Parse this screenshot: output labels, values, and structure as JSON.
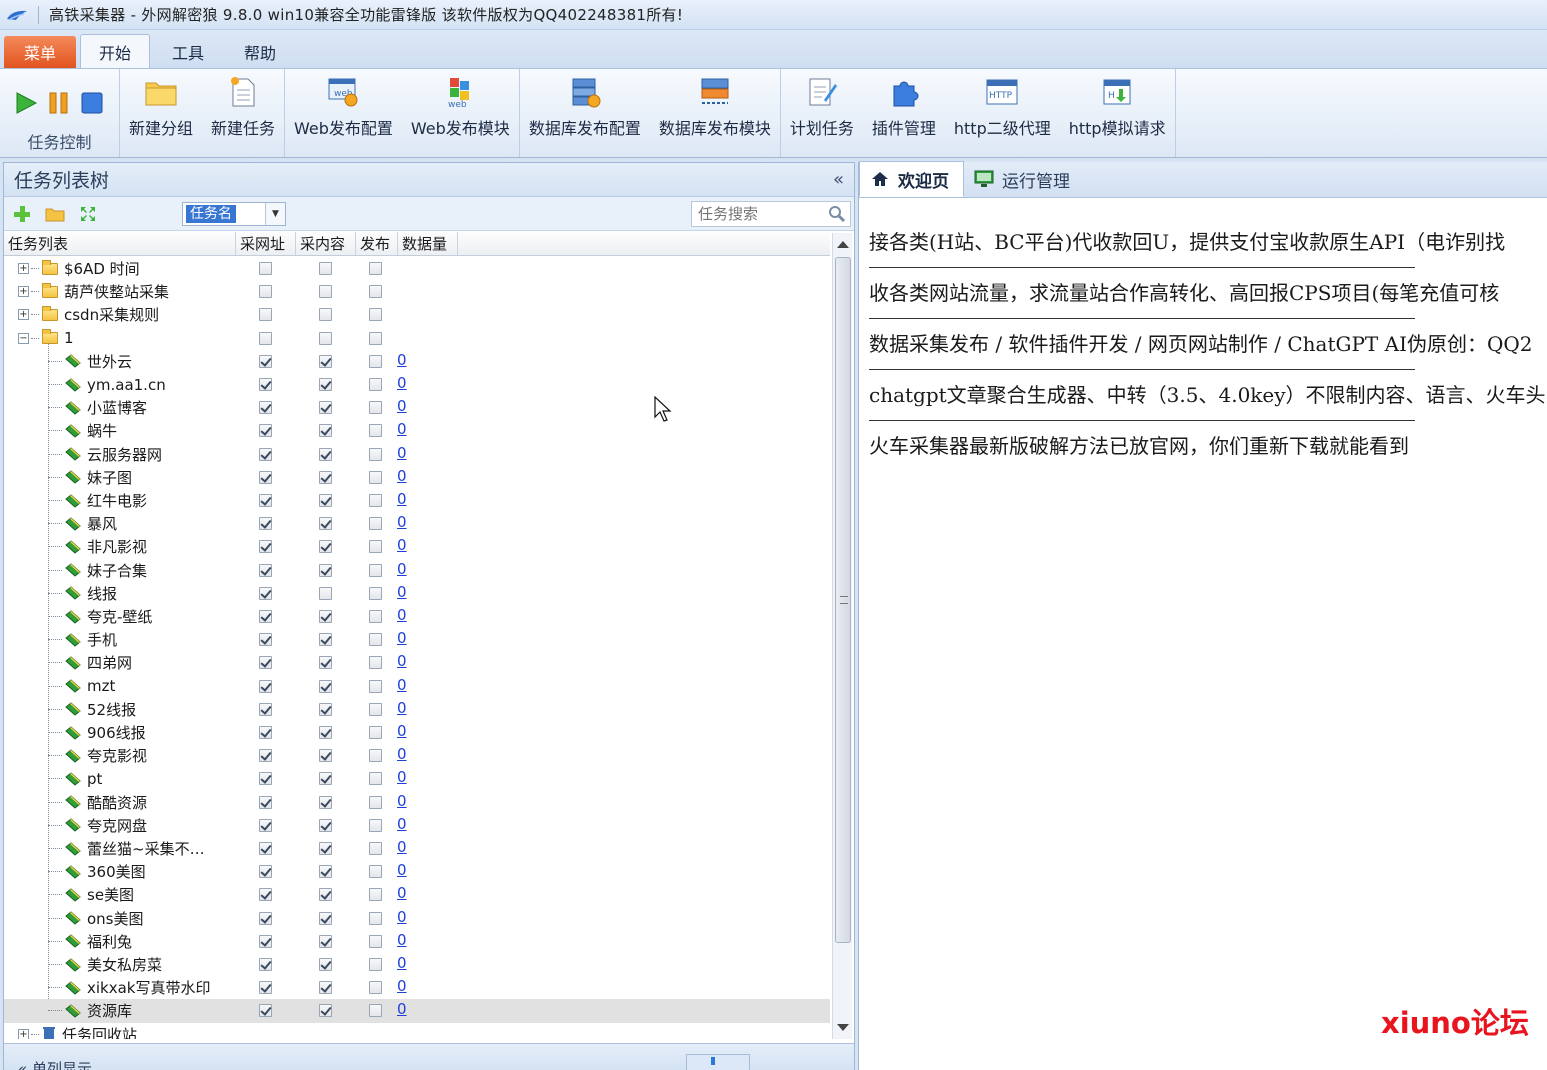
{
  "window": {
    "title": "高铁采集器 - 外网解密狼 9.8.0 win10兼容全功能雷锋版  该软件版权为QQ402248381所有!"
  },
  "ribbon_tabs": [
    "菜单",
    "开始",
    "工具",
    "帮助"
  ],
  "ribbon": {
    "control_group_title": "任务控制",
    "buttons": [
      {
        "label": "新建分组",
        "icon": "folder-icon"
      },
      {
        "label": "新建任务",
        "icon": "new-document-icon"
      },
      {
        "label": "Web发布配置",
        "icon": "web-config-icon"
      },
      {
        "label": "Web发布模块",
        "icon": "web-module-icon"
      },
      {
        "label": "数据库发布配置",
        "icon": "database-config-icon"
      },
      {
        "label": "数据库发布模块",
        "icon": "database-module-icon"
      },
      {
        "label": "计划任务",
        "icon": "schedule-icon"
      },
      {
        "label": "插件管理",
        "icon": "plugin-icon"
      },
      {
        "label": "http二级代理",
        "icon": "http-proxy-icon"
      },
      {
        "label": "http模拟请求",
        "icon": "http-request-icon"
      }
    ]
  },
  "left_panel": {
    "title": "任务列表树",
    "collapse": "«",
    "filter_select_value": "任务名",
    "search_placeholder": "任务搜索",
    "columns": [
      "任务列表",
      "采网址",
      "采内容",
      "发布",
      "数据量"
    ],
    "folders": [
      {
        "name": "$6AD 时间",
        "expander": "+"
      },
      {
        "name": "葫芦侠整站采集",
        "expander": "+"
      },
      {
        "name": "csdn采集规则",
        "expander": "+"
      },
      {
        "name": "1",
        "expander": "−"
      }
    ],
    "tasks": [
      {
        "name": "世外云",
        "url": true,
        "content": true,
        "publish": false,
        "count": "0"
      },
      {
        "name": "ym.aa1.cn",
        "url": true,
        "content": true,
        "publish": false,
        "count": "0"
      },
      {
        "name": "小蓝博客",
        "url": true,
        "content": true,
        "publish": false,
        "count": "0"
      },
      {
        "name": "蜗牛",
        "url": true,
        "content": true,
        "publish": false,
        "count": "0"
      },
      {
        "name": "云服务器网",
        "url": true,
        "content": true,
        "publish": false,
        "count": "0"
      },
      {
        "name": "妹子图",
        "url": true,
        "content": true,
        "publish": false,
        "count": "0"
      },
      {
        "name": "红牛电影",
        "url": true,
        "content": true,
        "publish": false,
        "count": "0"
      },
      {
        "name": "暴风",
        "url": true,
        "content": true,
        "publish": false,
        "count": "0"
      },
      {
        "name": "非凡影视",
        "url": true,
        "content": true,
        "publish": false,
        "count": "0"
      },
      {
        "name": "妹子合集",
        "url": true,
        "content": true,
        "publish": false,
        "count": "0"
      },
      {
        "name": "线报",
        "url": true,
        "content": false,
        "publish": false,
        "count": "0"
      },
      {
        "name": "夸克-壁纸",
        "url": true,
        "content": true,
        "publish": false,
        "count": "0"
      },
      {
        "name": "手机",
        "url": true,
        "content": true,
        "publish": false,
        "count": "0"
      },
      {
        "name": "四弟网",
        "url": true,
        "content": true,
        "publish": false,
        "count": "0"
      },
      {
        "name": "mzt",
        "url": true,
        "content": true,
        "publish": false,
        "count": "0"
      },
      {
        "name": "52线报",
        "url": true,
        "content": true,
        "publish": false,
        "count": "0"
      },
      {
        "name": "906线报",
        "url": true,
        "content": true,
        "publish": false,
        "count": "0"
      },
      {
        "name": "夸克影视",
        "url": true,
        "content": true,
        "publish": false,
        "count": "0"
      },
      {
        "name": "pt",
        "url": true,
        "content": true,
        "publish": false,
        "count": "0"
      },
      {
        "name": "酷酷资源",
        "url": true,
        "content": true,
        "publish": false,
        "count": "0"
      },
      {
        "name": "夸克网盘",
        "url": true,
        "content": true,
        "publish": false,
        "count": "0"
      },
      {
        "name": "蕾丝猫~采集不…",
        "url": true,
        "content": true,
        "publish": false,
        "count": "0"
      },
      {
        "name": "360美图",
        "url": true,
        "content": true,
        "publish": false,
        "count": "0"
      },
      {
        "name": "se美图",
        "url": true,
        "content": true,
        "publish": false,
        "count": "0"
      },
      {
        "name": "ons美图",
        "url": true,
        "content": true,
        "publish": false,
        "count": "0"
      },
      {
        "name": "福利兔",
        "url": true,
        "content": true,
        "publish": false,
        "count": "0"
      },
      {
        "name": "美女私房菜",
        "url": true,
        "content": true,
        "publish": false,
        "count": "0"
      },
      {
        "name": "xikxak写真带水印",
        "url": true,
        "content": true,
        "publish": false,
        "count": "0"
      },
      {
        "name": "资源库",
        "url": true,
        "content": true,
        "publish": false,
        "count": "0",
        "selected": true
      }
    ],
    "recycle_bin": "任务回收站",
    "footer_text": "« 单列显示"
  },
  "right_panel": {
    "tabs": [
      {
        "label": "欢迎页",
        "icon": "home-icon",
        "active": true
      },
      {
        "label": "运行管理",
        "icon": "monitor-icon",
        "active": false
      }
    ],
    "lines": [
      "接各类(H站、BC平台)代收款回U，提供支付宝收款原生API（电诈别找",
      "收各类网站流量，求流量站合作高转化、高回报CPS项目(每笔充值可核",
      "数据采集发布 / 软件插件开发 / 网页网站制作 / ChatGPT AI伪原创：QQ2",
      "chatgpt文章聚合生成器、中转（3.5、4.0key）不限制内容、语言、火车头",
      "火车采集器最新版破解方法已放官网，你们重新下载就能看到"
    ],
    "watermark": "xiuno论坛"
  }
}
